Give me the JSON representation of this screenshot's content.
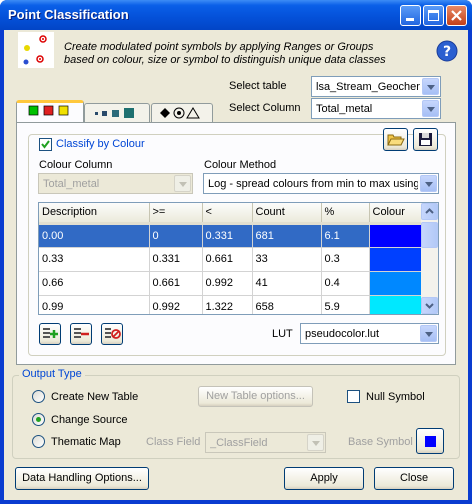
{
  "window": {
    "title": "Point Classification"
  },
  "header": {
    "description": "Create modulated point symbols by applying Ranges or Groups based on colour, size or symbol to distinguish unique data classes",
    "select_table_label": "Select table",
    "select_table_value": "lsa_Stream_Geochem",
    "select_column_label": "Select Column",
    "select_column_value": "Total_metal"
  },
  "classify": {
    "checkbox_label": "Classify by Colour",
    "colour_column_label": "Colour Column",
    "colour_column_value": "Total_metal",
    "colour_method_label": "Colour Method",
    "colour_method_value": "Log - spread colours from min to max using lo"
  },
  "table": {
    "columns": [
      "Description",
      ">=",
      "<",
      "Count",
      "%",
      "Colour"
    ],
    "rows": [
      {
        "description": "0.00",
        "ge": "0",
        "lt": "0.331",
        "count": "681",
        "pct": "6.1",
        "color": "#0000ff"
      },
      {
        "description": "0.33",
        "ge": "0.331",
        "lt": "0.661",
        "count": "33",
        "pct": "0.3",
        "color": "#0040ff"
      },
      {
        "description": "0.66",
        "ge": "0.661",
        "lt": "0.992",
        "count": "41",
        "pct": "0.4",
        "color": "#0088ff"
      },
      {
        "description": "0.99",
        "ge": "0.992",
        "lt": "1.322",
        "count": "658",
        "pct": "5.9",
        "color": "#00e8ff"
      }
    ]
  },
  "lut": {
    "label": "LUT",
    "value": "pseudocolor.lut"
  },
  "output": {
    "legend": "Output Type",
    "create_new_table": "Create New Table",
    "change_source": "Change Source",
    "thematic_map": "Thematic Map",
    "new_table_options": "New Table options...",
    "null_symbol": "Null Symbol",
    "class_field_label": "Class Field",
    "class_field_value": "_ClassField",
    "base_symbol_label": "Base Symbol",
    "base_symbol_color": "#0000ff"
  },
  "footer": {
    "data_handling": "Data Handling Options...",
    "apply": "Apply",
    "close": "Close"
  }
}
